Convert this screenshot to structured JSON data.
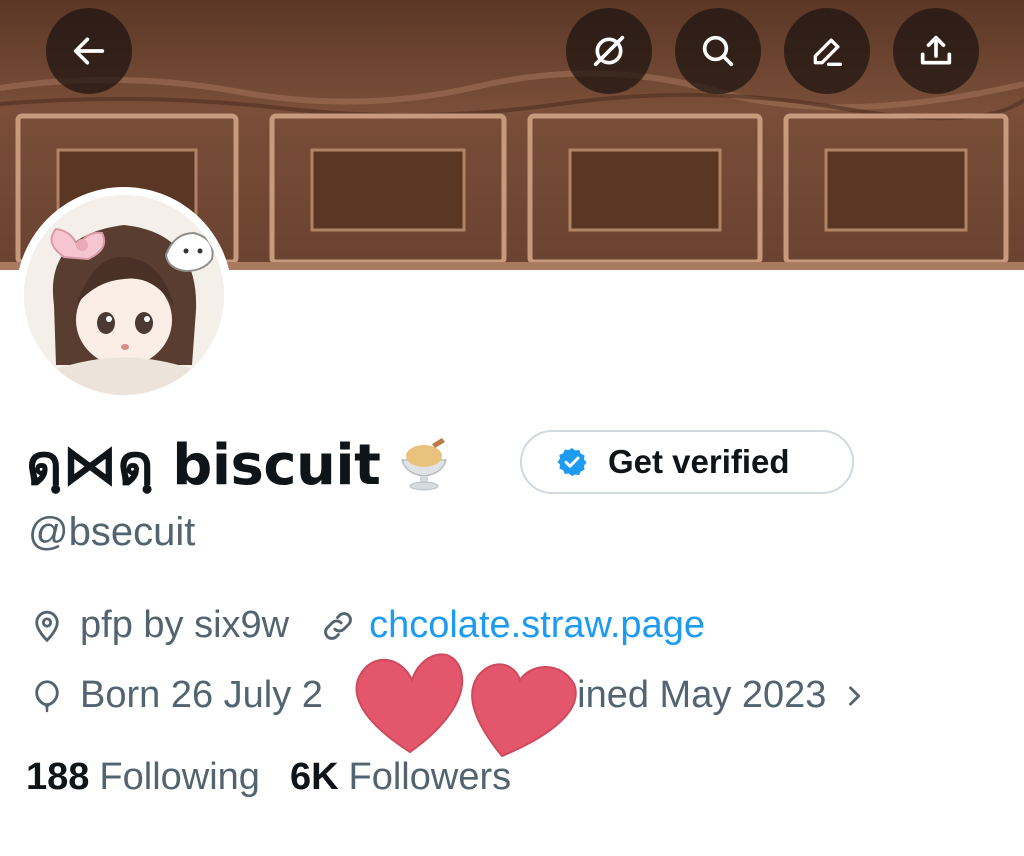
{
  "header": {
    "buttons": [
      {
        "name": "back",
        "icon": "arrow-left-icon"
      },
      {
        "name": "grok",
        "icon": "slashed-circle-icon"
      },
      {
        "name": "search",
        "icon": "search-icon"
      },
      {
        "name": "edit",
        "icon": "pencil-icon"
      },
      {
        "name": "share",
        "icon": "upload-icon"
      }
    ]
  },
  "profile": {
    "display_name": "ดฺ⋈ดฺ biscuit",
    "emoji": "sundae-icon",
    "handle": "@bsecuit",
    "verify_label": "Get verified",
    "location_text": "pfp by six9w",
    "website": "chcolate.straw.page",
    "birth_text": "Born 26 July 2",
    "joined_text": "oined May 2023"
  },
  "stats": {
    "following_count": "188",
    "following_label": "Following",
    "followers_count": "6K",
    "followers_label": "Followers"
  },
  "colors": {
    "banner": "#6b4330",
    "link": "#1d9bf0",
    "verified": "#1d9bf0",
    "secondary_text": "#536471",
    "heart": "#e4566b"
  }
}
